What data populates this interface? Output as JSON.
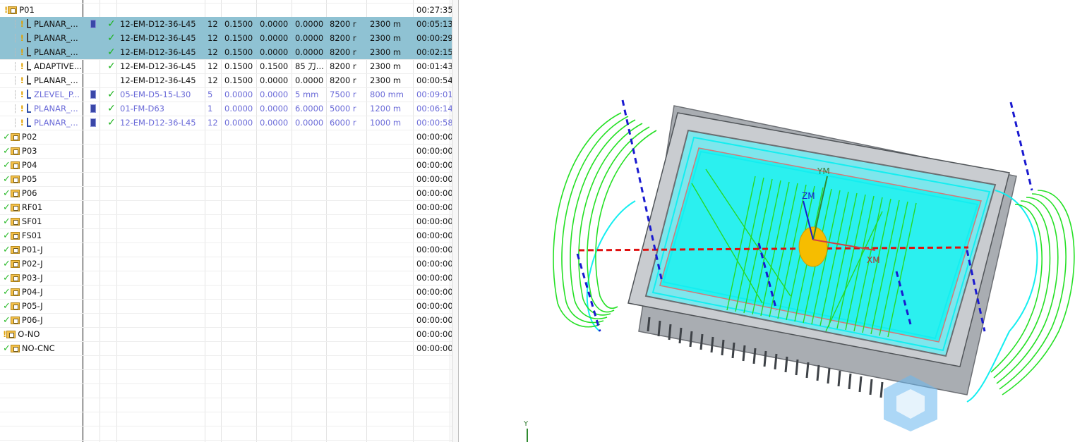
{
  "operations": [
    {
      "name": "PLANAR_...",
      "tool": "12-EM-D12-36-L45",
      "num": "12",
      "a": "0.1500",
      "b": "0.0000",
      "c": "0.0000",
      "speed": "8200 r",
      "feed": "2300 m",
      "time": "00:05:13",
      "selected": true,
      "purple": false,
      "icon": true,
      "check": true
    },
    {
      "name": "PLANAR_...",
      "tool": "12-EM-D12-36-L45",
      "num": "12",
      "a": "0.1500",
      "b": "0.0000",
      "c": "0.0000",
      "speed": "8200 r",
      "feed": "2300 m",
      "time": "00:00:29",
      "selected": true,
      "purple": false,
      "icon": false,
      "check": true
    },
    {
      "name": "PLANAR_...",
      "tool": "12-EM-D12-36-L45",
      "num": "12",
      "a": "0.1500",
      "b": "0.0000",
      "c": "0.0000",
      "speed": "8200 r",
      "feed": "2300 m",
      "time": "00:02:15",
      "selected": true,
      "purple": false,
      "icon": false,
      "check": true
    },
    {
      "name": "ADAPTIVE...",
      "tool": "12-EM-D12-36-L45",
      "num": "12",
      "a": "0.1500",
      "b": "0.1500",
      "c": "85 刀...",
      "speed": "8200 r",
      "feed": "2300 m",
      "time": "00:01:43",
      "selected": false,
      "purple": false,
      "icon": false,
      "check": true
    },
    {
      "name": "PLANAR_...",
      "tool": "12-EM-D12-36-L45",
      "num": "12",
      "a": "0.1500",
      "b": "0.0000",
      "c": "0.0000",
      "speed": "8200 r",
      "feed": "2300 m",
      "time": "00:00:54",
      "selected": false,
      "purple": false,
      "icon": false,
      "check": false
    },
    {
      "name": "ZLEVEL_P...",
      "tool": "05-EM-D5-15-L30",
      "num": "5",
      "a": "0.0000",
      "b": "0.0000",
      "c": "5 mm",
      "speed": "7500 r",
      "feed": "800 mm",
      "time": "00:09:01",
      "selected": false,
      "purple": true,
      "icon": true,
      "check": true
    },
    {
      "name": "PLANAR_...",
      "tool": "01-FM-D63",
      "num": "1",
      "a": "0.0000",
      "b": "0.0000",
      "c": "6.0000",
      "speed": "5000 r",
      "feed": "1200 m",
      "time": "00:06:14",
      "selected": false,
      "purple": true,
      "icon": true,
      "check": true
    },
    {
      "name": "PLANAR_...",
      "tool": "12-EM-D12-36-L45",
      "num": "12",
      "a": "0.0000",
      "b": "0.0000",
      "c": "0.0000",
      "speed": "6000 r",
      "feed": "1000 m",
      "time": "00:00:58",
      "selected": false,
      "purple": true,
      "icon": true,
      "check": true
    }
  ],
  "groups": [
    {
      "name": "P01",
      "time": "00:27:35"
    },
    {
      "name": "P02",
      "time": "00:00:00"
    },
    {
      "name": "P03",
      "time": "00:00:00"
    },
    {
      "name": "P04",
      "time": "00:00:00"
    },
    {
      "name": "P05",
      "time": "00:00:00"
    },
    {
      "name": "P06",
      "time": "00:00:00"
    },
    {
      "name": "RF01",
      "time": "00:00:00"
    },
    {
      "name": "SF01",
      "time": "00:00:00"
    },
    {
      "name": "FS01",
      "time": "00:00:00"
    },
    {
      "name": "P01-J",
      "time": "00:00:00"
    },
    {
      "name": "P02-J",
      "time": "00:00:00"
    },
    {
      "name": "P03-J",
      "time": "00:00:00"
    },
    {
      "name": "P04-J",
      "time": "00:00:00"
    },
    {
      "name": "P05-J",
      "time": "00:00:00"
    },
    {
      "name": "P06-J",
      "time": "00:00:00"
    },
    {
      "name": "O-NO",
      "time": "00:00:00"
    },
    {
      "name": "NO-CNC",
      "time": "00:00:00"
    }
  ],
  "viewport": {
    "labels": {
      "ym": "YM",
      "zm": "ZM",
      "xm": "XM",
      "y": "Y"
    },
    "colors": {
      "toolpath_green": "#22e022",
      "toolpath_cyan": "#22f0f0",
      "part_gray": "#b8bcc0",
      "axis_blue": "#1a1ad0",
      "axis_red": "#e01010",
      "tool_yellow": "#f6bd00",
      "watermark": "#6ab8f0"
    }
  }
}
